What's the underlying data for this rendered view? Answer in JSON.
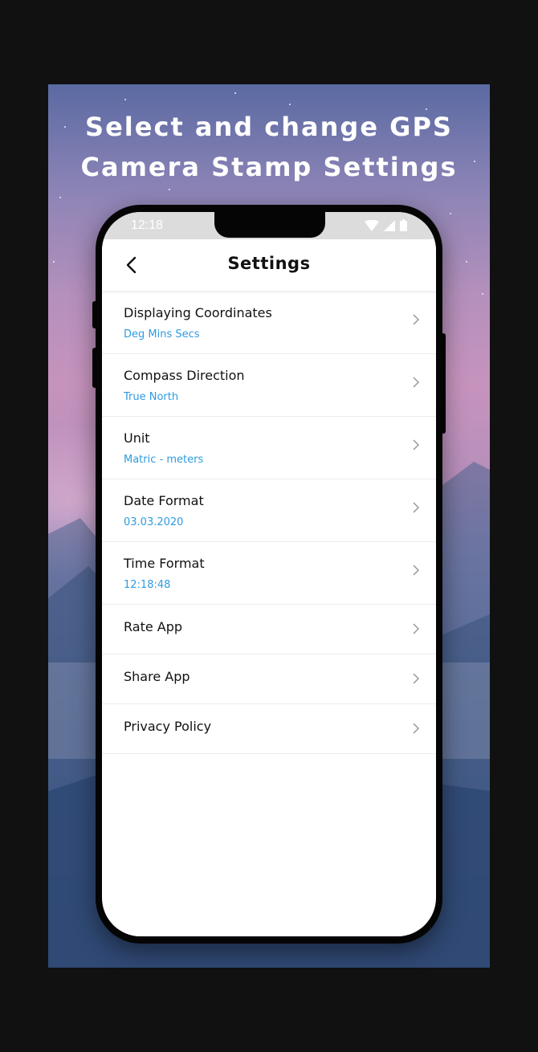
{
  "headline": {
    "line1": "Select and change GPS",
    "line2": "Camera Stamp Settings"
  },
  "phone": {
    "status_bar": {
      "time": "12:18",
      "icons": [
        "wifi-icon",
        "signal-icon",
        "battery-icon"
      ]
    },
    "app_bar": {
      "back_icon": "back-arrow-icon",
      "title": "Settings"
    },
    "settings": [
      {
        "label": "Displaying Coordinates",
        "value": "Deg Mins Secs"
      },
      {
        "label": "Compass Direction",
        "value": "True North"
      },
      {
        "label": "Unit",
        "value": "Matric - meters"
      },
      {
        "label": "Date Format",
        "value": "03.03.2020"
      },
      {
        "label": "Time Format",
        "value": "12:18:48"
      },
      {
        "label": "Rate App"
      },
      {
        "label": "Share App"
      },
      {
        "label": "Privacy Policy"
      }
    ]
  },
  "colors": {
    "accent": "#2f9be0",
    "text": "#111111",
    "page_background": "#111111"
  }
}
